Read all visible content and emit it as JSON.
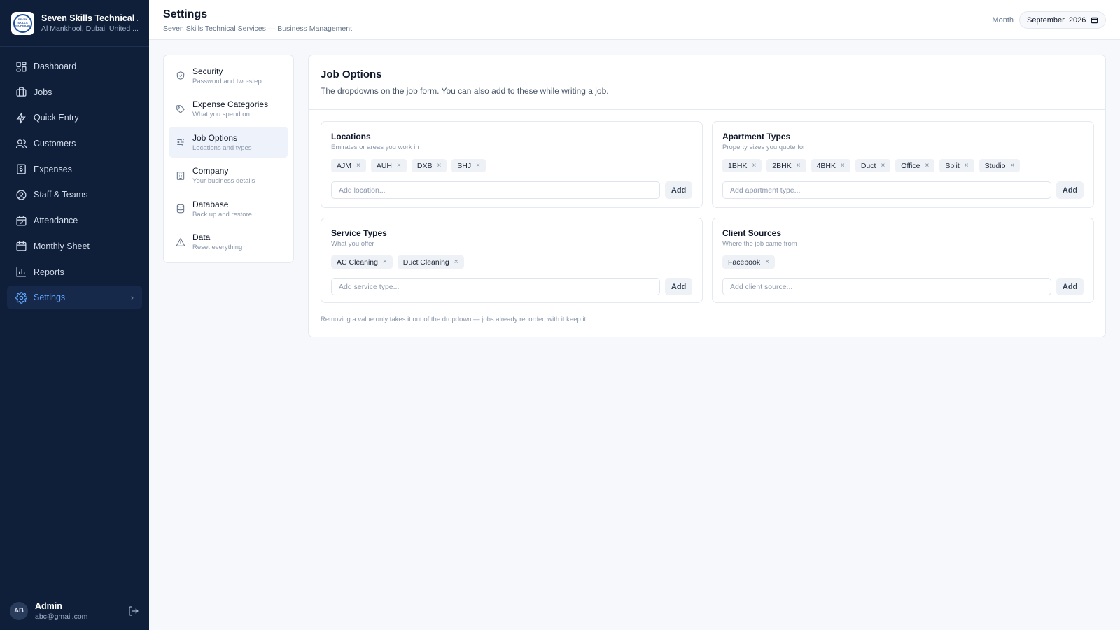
{
  "brand": {
    "title": "Seven Skills Technical ...",
    "subtitle": "Al Mankhool, Dubai, United ...",
    "logo_text": "SEVEN SKILLS TECHNICAL"
  },
  "nav": [
    {
      "label": "Dashboard",
      "icon": "dashboard-icon",
      "active": false
    },
    {
      "label": "Jobs",
      "icon": "briefcase-icon",
      "active": false
    },
    {
      "label": "Quick Entry",
      "icon": "lightning-icon",
      "active": false
    },
    {
      "label": "Customers",
      "icon": "users-icon",
      "active": false
    },
    {
      "label": "Expenses",
      "icon": "receipt-icon",
      "active": false
    },
    {
      "label": "Staff & Teams",
      "icon": "user-circle-icon",
      "active": false
    },
    {
      "label": "Attendance",
      "icon": "calendar-check-icon",
      "active": false
    },
    {
      "label": "Monthly Sheet",
      "icon": "calendar-icon",
      "active": false
    },
    {
      "label": "Reports",
      "icon": "bar-chart-icon",
      "active": false
    },
    {
      "label": "Settings",
      "icon": "gear-icon",
      "active": true
    }
  ],
  "user": {
    "initials": "AB",
    "name": "Admin",
    "email": "abc@gmail.com"
  },
  "header": {
    "title": "Settings",
    "subtitle": "Seven Skills Technical Services — Business Management",
    "month_label": "Month",
    "month_value": "September  2026"
  },
  "settings_nav": [
    {
      "label": "Security",
      "desc": "Password and two-step",
      "icon": "shield-icon",
      "active": false
    },
    {
      "label": "Expense Categories",
      "desc": "What you spend on",
      "icon": "tag-icon",
      "active": false
    },
    {
      "label": "Job Options",
      "desc": "Locations and types",
      "icon": "sliders-icon",
      "active": true
    },
    {
      "label": "Company",
      "desc": "Your business details",
      "icon": "building-icon",
      "active": false
    },
    {
      "label": "Database",
      "desc": "Back up and restore",
      "icon": "database-icon",
      "active": false
    },
    {
      "label": "Data",
      "desc": "Reset everything",
      "icon": "warning-icon",
      "active": false
    }
  ],
  "panel": {
    "title": "Job Options",
    "description": "The dropdowns on the job form. You can also add to these while writing a job.",
    "footnote": "Removing a value only takes it out of the dropdown — jobs already recorded with it keep it."
  },
  "cards": [
    {
      "title": "Locations",
      "desc": "Emirates or areas you work in",
      "chips": [
        "AJM",
        "AUH",
        "DXB",
        "SHJ"
      ],
      "placeholder": "Add location...",
      "button": "Add"
    },
    {
      "title": "Apartment Types",
      "desc": "Property sizes you quote for",
      "chips": [
        "1BHK",
        "2BHK",
        "4BHK",
        "Duct",
        "Office",
        "Split",
        "Studio"
      ],
      "placeholder": "Add apartment type...",
      "button": "Add"
    },
    {
      "title": "Service Types",
      "desc": "What you offer",
      "chips": [
        "AC Cleaning",
        "Duct Cleaning"
      ],
      "placeholder": "Add service type...",
      "button": "Add"
    },
    {
      "title": "Client Sources",
      "desc": "Where the job came from",
      "chips": [
        "Facebook"
      ],
      "placeholder": "Add client source...",
      "button": "Add"
    }
  ],
  "chip_remove_glyph": "×",
  "colors": {
    "sidebar_bg": "#0f1f3a",
    "accent": "#5ea6ff",
    "page_bg": "#f6f8fb"
  }
}
